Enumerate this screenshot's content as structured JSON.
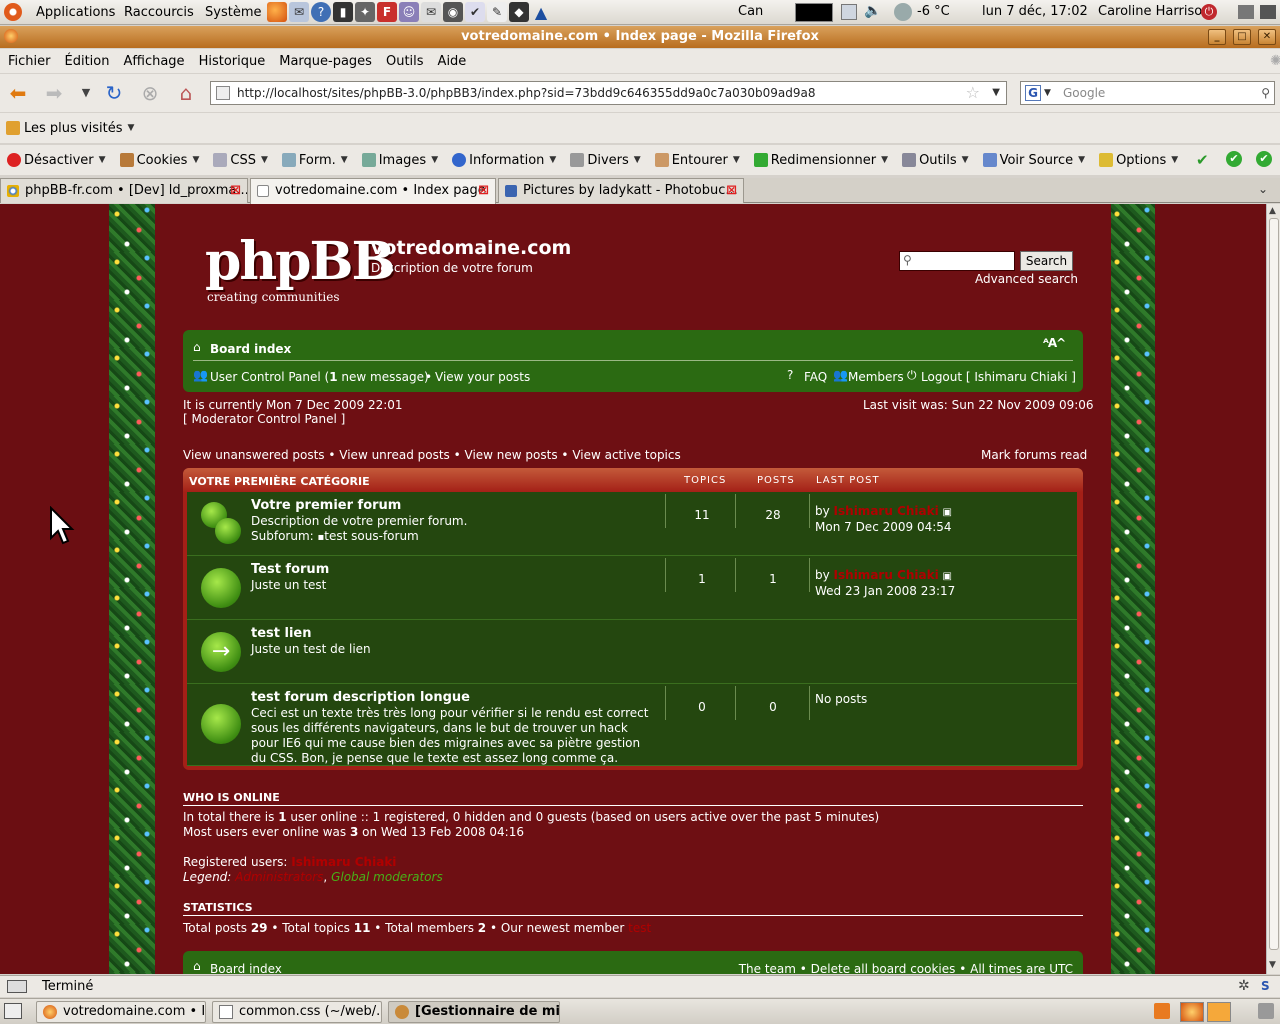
{
  "gnome_panel": {
    "menus": [
      "Applications",
      "Raccourcis",
      "Système"
    ],
    "weather_location": "Can",
    "temperature": "-6 °C",
    "datetime": "lun  7 déc, 17:02",
    "user": "Caroline Harrison"
  },
  "window": {
    "title": "votredomaine.com • Index page - Mozilla Firefox"
  },
  "firefox_menu": [
    "Fichier",
    "Édition",
    "Affichage",
    "Historique",
    "Marque-pages",
    "Outils",
    "Aide"
  ],
  "url": "http://localhost/sites/phpBB-3.0/phpBB3/index.php?sid=73bdd9c646355dd9a0c7a030b09ad9a8",
  "search_placeholder": "Google",
  "bookmarks_label": "Les plus visités",
  "webdev": [
    "Désactiver",
    "Cookies",
    "CSS",
    "Form.",
    "Images",
    "Information",
    "Divers",
    "Entourer",
    "Redimensionner",
    "Outils",
    "Voir Source",
    "Options"
  ],
  "tabs": [
    "phpBB-fr.com • [Dev] ld_proxma...",
    "votredomaine.com • Index page",
    "Pictures by ladykatt - Photobuc..."
  ],
  "forum": {
    "site_name": "votredomaine.com",
    "site_desc": "Description de votre forum",
    "logo_text": "phpBB",
    "logo_tagline": "creating communities",
    "search_button": "Search",
    "advanced_search": "Advanced search",
    "board_index": "Board index",
    "ucp": "User Control Panel (",
    "ucp_count": "1",
    "ucp_suffix": " new message)",
    "view_posts": "View your posts",
    "faq": "FAQ",
    "members": "Members",
    "logout": "Logout [ Ishimaru Chiaki ]",
    "current_time": "It is currently Mon 7 Dec 2009 22:01",
    "mcp": "[ Moderator Control Panel ]",
    "last_visit": "Last visit was: Sun 22 Nov 2009 09:06",
    "quick_links": [
      "View unanswered posts",
      "View unread posts",
      "View new posts",
      "View active topics"
    ],
    "mark_read": "Mark forums read",
    "category": "VOTRE PREMIÈRE CATÉGORIE",
    "col_topics": "TOPICS",
    "col_posts": "POSTS",
    "col_last": "LAST POST",
    "rows": [
      {
        "title": "Votre premier forum",
        "desc": "Description de votre premier forum.",
        "subforum_label": "Subforum:",
        "subforum": "test sous-forum",
        "topics": "11",
        "posts": "28",
        "lp_by": "by",
        "lp_user": "Ishimaru Chiaki",
        "lp_date": "Mon 7 Dec 2009 04:54"
      },
      {
        "title": "Test forum",
        "desc": "Juste un test",
        "topics": "1",
        "posts": "1",
        "lp_by": "by",
        "lp_user": "Ishimaru Chiaki",
        "lp_date": "Wed 23 Jan 2008 23:17"
      },
      {
        "title": "test lien",
        "desc": "Juste un test de lien"
      },
      {
        "title": "test forum description longue",
        "desc": "Ceci est un texte très très long pour vérifier si le rendu est correct sous les différents navigateurs, dans le but de trouver un hack pour IE6 qui me cause bien des migraines avec sa piètre gestion du CSS. Bon, je pense que le texte est assez long comme ça.",
        "topics": "0",
        "posts": "0",
        "lp_none": "No posts"
      }
    ],
    "online_title": "WHO IS ONLINE",
    "online_pre": "In total there is ",
    "online_n": "1",
    "online_post": " user online :: 1 registered, 0 hidden and 0 guests (based on users active over the past 5 minutes)",
    "most_pre": "Most users ever online was ",
    "most_n": "3",
    "most_post": " on Wed 13 Feb 2008 04:16",
    "reg_label": "Registered users: ",
    "reg_user": "Ishimaru Chiaki",
    "legend_label": "Legend: ",
    "legend_admin": "Administrators",
    "legend_mods": "Global moderators",
    "stats_title": "STATISTICS",
    "stats_posts_l": "Total posts ",
    "stats_posts": "29",
    "stats_topics_l": " • Total topics ",
    "stats_topics": "11",
    "stats_members_l": " • Total members ",
    "stats_members": "2",
    "stats_newest_l": " • Our newest member ",
    "stats_newest": "test",
    "footer_board": "Board index",
    "footer_links": "The team • Delete all board cookies • All times are UTC"
  },
  "status": "Terminé",
  "taskbar": [
    "votredomaine.com • I...",
    "common.css (~/web/...",
    "[Gestionnaire de mi..."
  ],
  "colors": {
    "page_bg": "#6b0e12",
    "forum_green": "#2b6a12",
    "row_green": "#24470f",
    "title_orange": "#c47a2a"
  }
}
